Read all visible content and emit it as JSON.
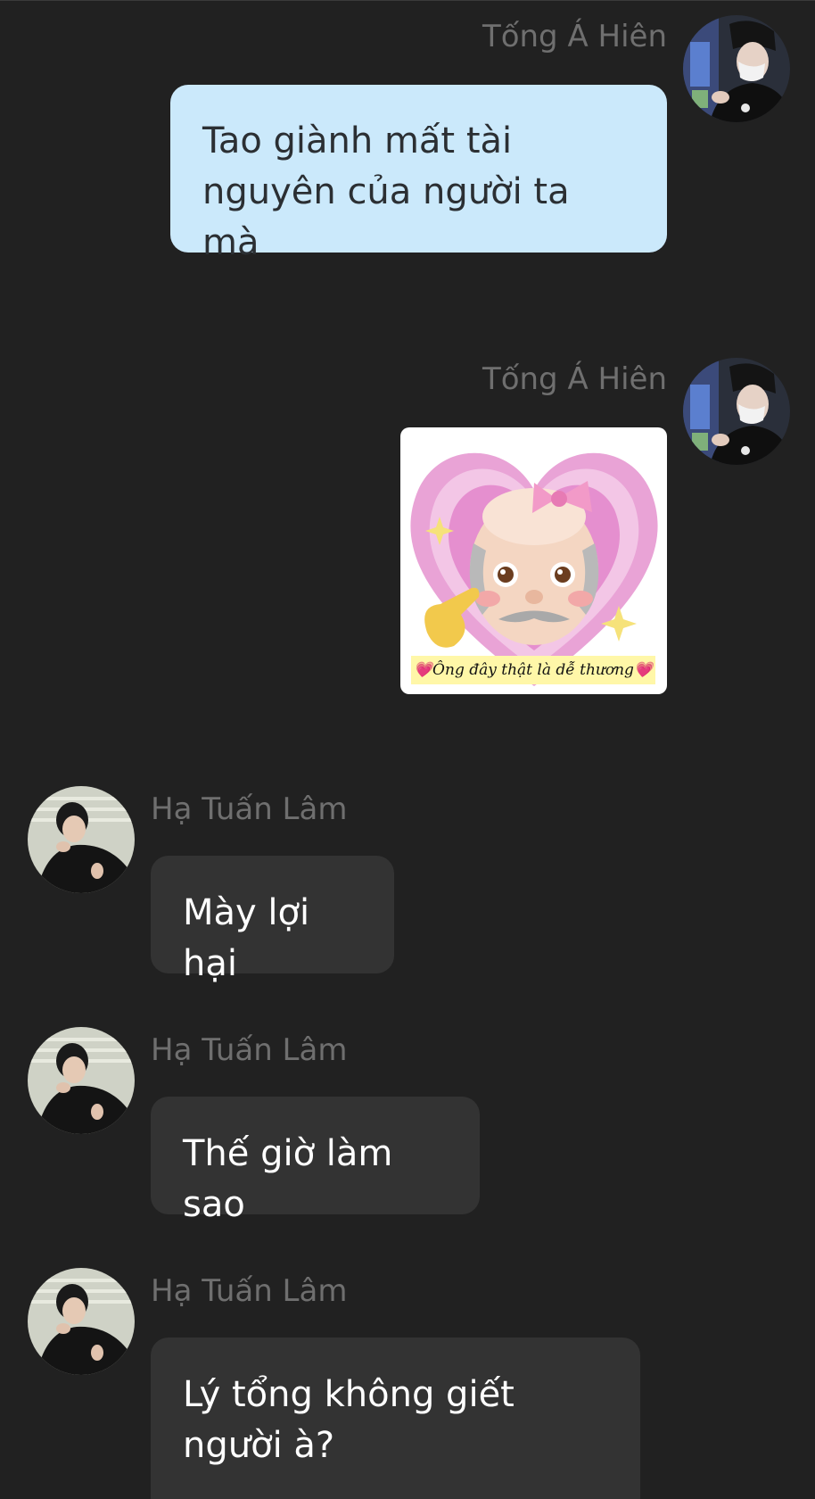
{
  "messages": [
    {
      "sender": "Tống Á Hiên",
      "side": "right",
      "type": "text",
      "text": "Tao giành mất tài nguyên của người ta mà"
    },
    {
      "sender": "Tống Á Hiên",
      "side": "right",
      "type": "sticker",
      "caption": "💗Ông đây thật là dễ thương💗",
      "icon": "old-man-heart-sticker"
    },
    {
      "sender": "Hạ Tuấn Lâm",
      "side": "left",
      "type": "text",
      "text": "Mày lợi hại"
    },
    {
      "sender": "Hạ Tuấn Lâm",
      "side": "left",
      "type": "text",
      "text": "Thế giờ làm sao"
    },
    {
      "sender": "Hạ Tuấn Lâm",
      "side": "left",
      "type": "text",
      "text": "Lý tổng không giết người à?"
    }
  ],
  "colors": {
    "background": "#212121",
    "my_bubble": "#cbe9fb",
    "their_bubble": "#333333",
    "sender_name": "#6f6f6f"
  }
}
